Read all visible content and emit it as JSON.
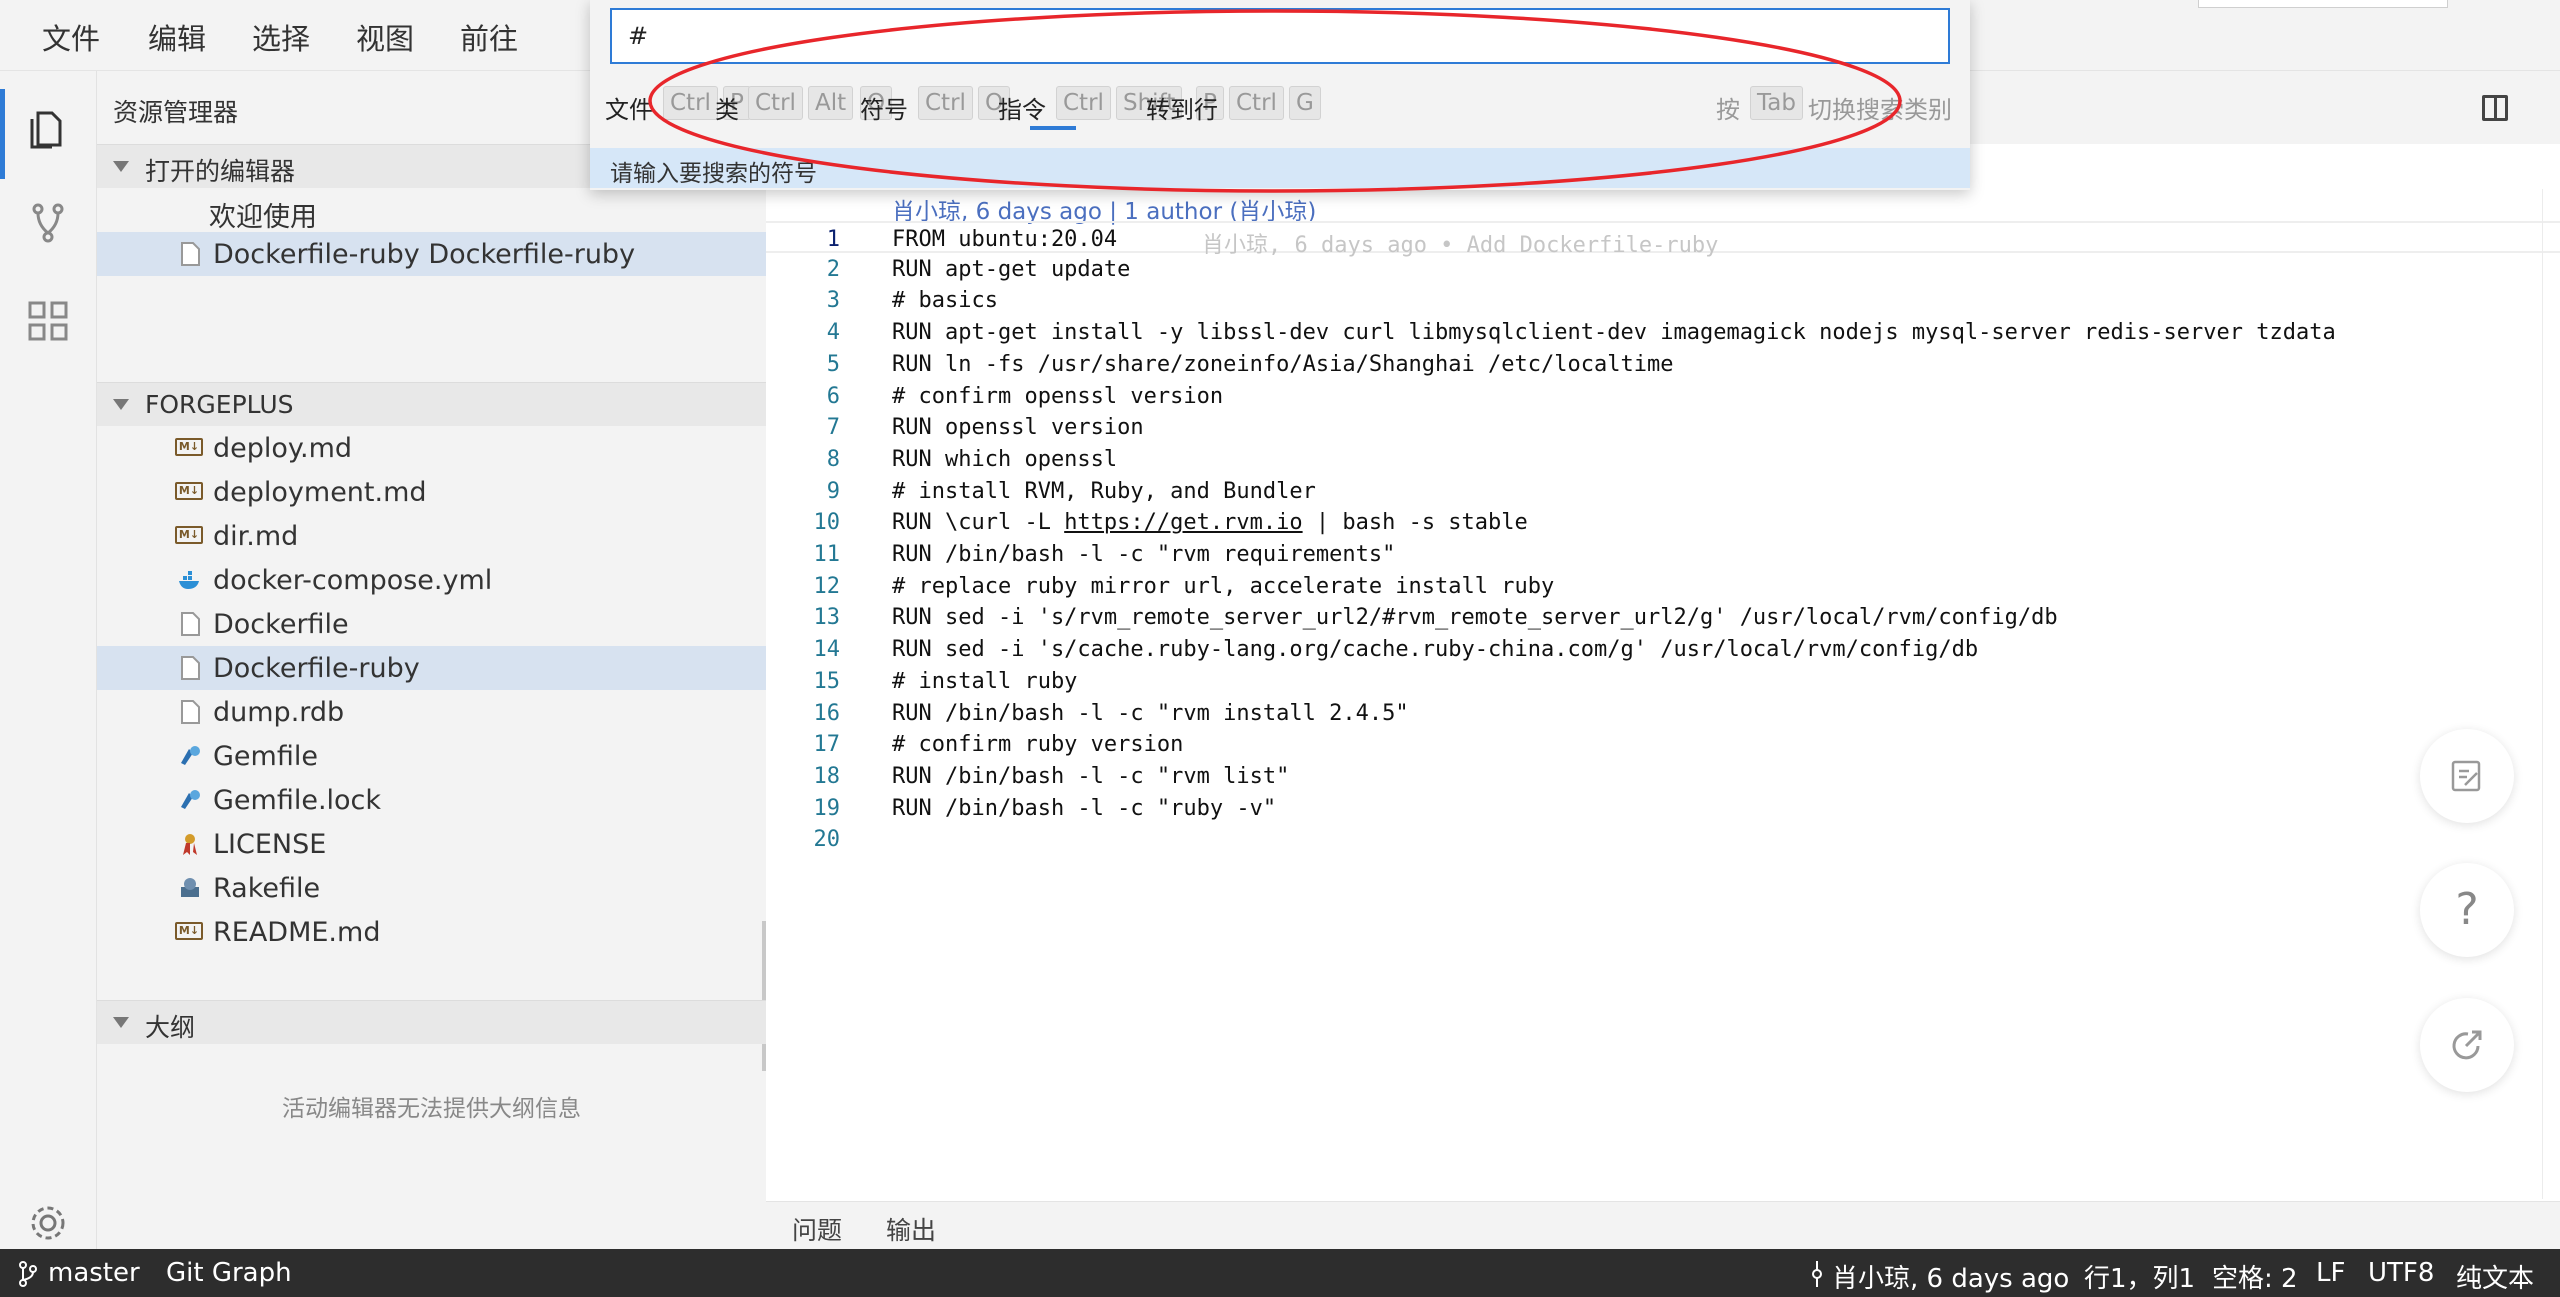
{
  "menu": [
    "文件",
    "编辑",
    "选择",
    "视图",
    "前往"
  ],
  "sidebar": {
    "title": "资源管理器",
    "open_editors": {
      "header": "打开的编辑器",
      "items": [
        {
          "label": "欢迎使用"
        },
        {
          "label": "Dockerfile-ruby  Dockerfile-ruby"
        }
      ]
    },
    "workspace": {
      "header": "FORGEPLUS",
      "files": [
        {
          "label": "deploy.md",
          "icon": "markdown-icon"
        },
        {
          "label": "deployment.md",
          "icon": "markdown-icon"
        },
        {
          "label": "dir.md",
          "icon": "markdown-icon"
        },
        {
          "label": "docker-compose.yml",
          "icon": "docker-icon"
        },
        {
          "label": "Dockerfile",
          "icon": "file-icon"
        },
        {
          "label": "Dockerfile-ruby",
          "icon": "file-icon"
        },
        {
          "label": "dump.rdb",
          "icon": "file-icon"
        },
        {
          "label": "Gemfile",
          "icon": "ruby-gem-icon"
        },
        {
          "label": "Gemfile.lock",
          "icon": "ruby-gem-icon"
        },
        {
          "label": "LICENSE",
          "icon": "license-icon"
        },
        {
          "label": "Rakefile",
          "icon": "rake-icon"
        },
        {
          "label": "README.md",
          "icon": "markdown-icon"
        }
      ]
    },
    "outline": {
      "header": "大纲",
      "message": "活动编辑器无法提供大纲信息"
    }
  },
  "quick_open": {
    "value": "#",
    "options": [
      {
        "label": "文件",
        "keys": [
          "Ctrl",
          "P"
        ]
      },
      {
        "label": "类",
        "keys": [
          "Ctrl",
          "Alt",
          "O"
        ]
      },
      {
        "label": "符号",
        "keys": [
          "Ctrl",
          "O"
        ]
      },
      {
        "label": "指令",
        "keys": [
          "Ctrl",
          "Shift",
          "P"
        ]
      },
      {
        "label": "转到行",
        "keys": [
          "Ctrl",
          "G"
        ]
      }
    ],
    "press_label": "按",
    "press_key": "Tab",
    "switch_label": "切换搜索类别",
    "hint": "请输入要搜索的符号",
    "annotation_color": "#e8262b"
  },
  "editor": {
    "blame_header": "肖小琼, 6 days ago | 1 author (肖小琼)",
    "blame_inline": "肖小琼, 6 days ago • Add Dockerfile-ruby",
    "lines": [
      "FROM ubuntu:20.04",
      "RUN apt-get update",
      "# basics",
      "RUN apt-get install -y libssl-dev curl libmysqlclient-dev imagemagick nodejs mysql-server redis-server tzdata",
      "RUN ln -fs /usr/share/zoneinfo/Asia/Shanghai /etc/localtime",
      "# confirm openssl version",
      "RUN openssl version",
      "RUN which openssl",
      "# install RVM, Ruby, and Bundler",
      "RUN \\curl -L https://get.rvm.io | bash -s stable",
      "RUN /bin/bash -l -c \"rvm requirements\"",
      "# replace ruby mirror url, accelerate install ruby",
      "RUN sed -i 's/rvm_remote_server_url2/#rvm_remote_server_url2/g' /usr/local/rvm/config/db",
      "RUN sed -i 's/cache.ruby-lang.org/cache.ruby-china.com/g' /usr/local/rvm/config/db",
      "# install ruby",
      "RUN /bin/bash -l -c \"rvm install 2.4.5\"",
      "# confirm ruby version",
      "RUN /bin/bash -l -c \"rvm list\"",
      "RUN /bin/bash -l -c \"ruby -v\"",
      ""
    ],
    "line10": {
      "prefix": "RUN \\curl -L ",
      "link": "https://get.rvm.io",
      "suffix": " | bash -s stable"
    }
  },
  "panel": {
    "tabs": [
      "问题",
      "输出"
    ]
  },
  "statusbar": {
    "branch": "master",
    "git_graph": "Git Graph",
    "blame": "肖小琼, 6 days ago",
    "position": "行1，列1",
    "spaces": "空格: 2",
    "eol": "LF",
    "encoding": "UTF8",
    "language": "纯文本"
  },
  "colors": {
    "accent": "#2e7bd6",
    "statusbar": "#2d2d2d",
    "selection": "#d7e2f0",
    "annotation": "#e8262b"
  }
}
